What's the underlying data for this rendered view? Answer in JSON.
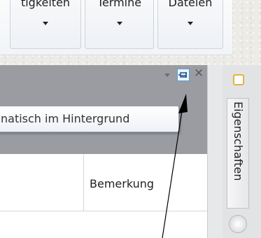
{
  "ribbon": {
    "buttons": [
      {
        "label": "tigkeiten"
      },
      {
        "label": "Termine"
      },
      {
        "label": "Dateien"
      }
    ]
  },
  "panel": {
    "tooltip_text": "natisch im Hintergrund",
    "column_header": "Bemerkung"
  },
  "side_panel": {
    "tab_label": "Eigenschaften"
  },
  "colors": {
    "panel_header": "#9a9ca1",
    "pin_highlight": "#5b9bd5",
    "accent_folder": "#e3b33f"
  },
  "icons": [
    "dropdown-chevron-icon",
    "pin-icon",
    "close-icon",
    "folder-icon",
    "circle-icon"
  ]
}
